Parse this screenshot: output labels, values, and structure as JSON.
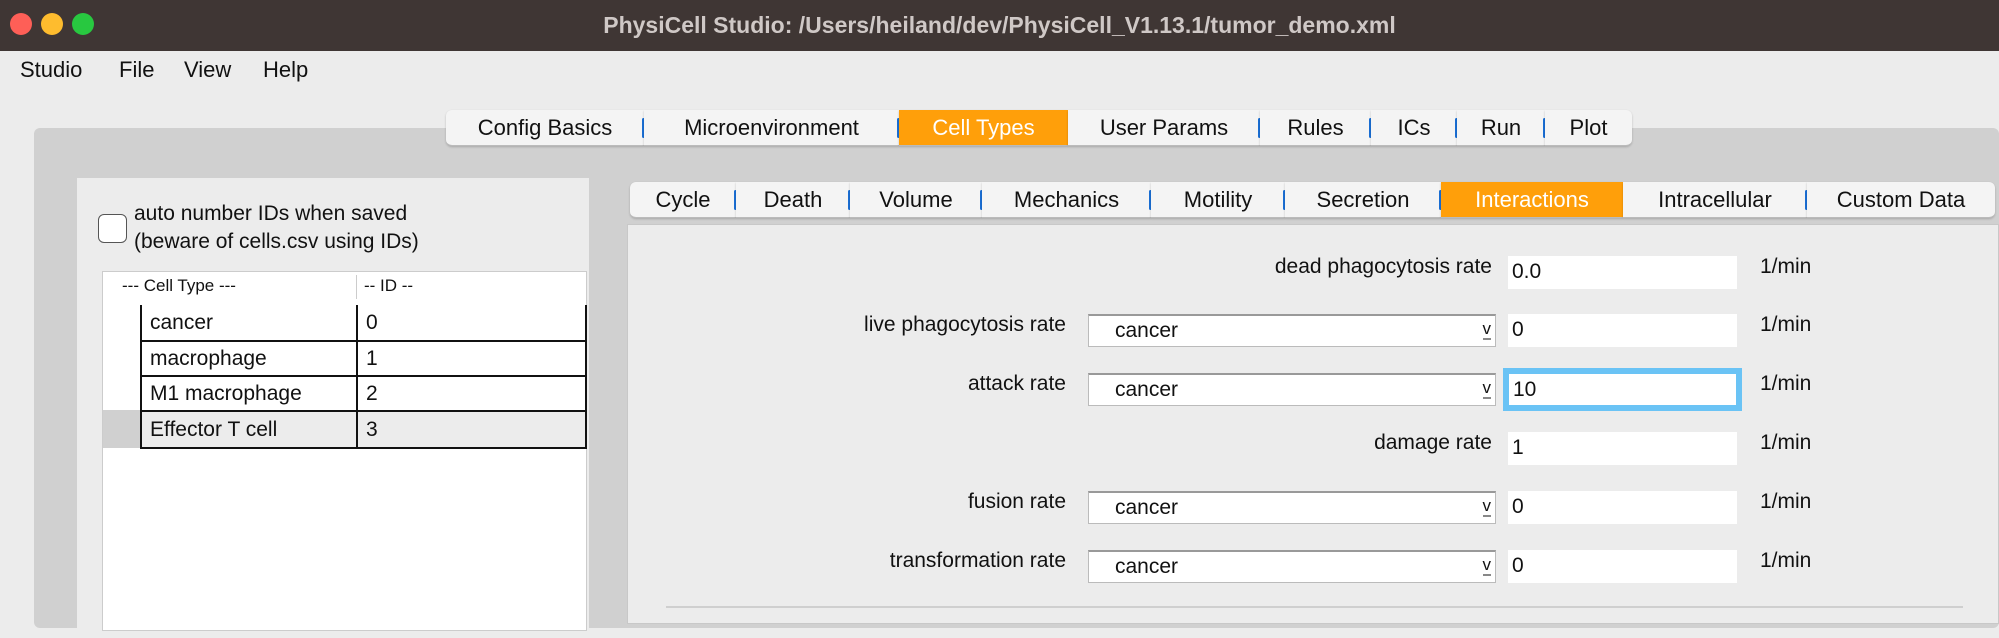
{
  "window": {
    "title": "PhysiCell Studio: /Users/heiland/dev/PhysiCell_V1.13.1/tumor_demo.xml",
    "lights": [
      "#fe5f57",
      "#febc2e",
      "#28c840"
    ]
  },
  "menu": [
    "Studio",
    "File",
    "View",
    "Help"
  ],
  "main_tabs": [
    {
      "label": "Config Basics"
    },
    {
      "label": "Microenvironment"
    },
    {
      "label": "Cell Types",
      "active": true
    },
    {
      "label": "User Params"
    },
    {
      "label": "Rules"
    },
    {
      "label": "ICs"
    },
    {
      "label": "Run"
    },
    {
      "label": "Plot"
    }
  ],
  "left": {
    "checkbox_line1": "auto number IDs when saved",
    "checkbox_line2": "(beware of cells.csv using IDs)",
    "checked": false,
    "headers": [
      "---  Cell Type ---",
      "-- ID --"
    ],
    "rows": [
      {
        "name": "cancer",
        "id": "0"
      },
      {
        "name": "macrophage",
        "id": "1"
      },
      {
        "name": "M1 macrophage",
        "id": "2"
      },
      {
        "name": "Effector T cell",
        "id": "3",
        "selected": true
      }
    ]
  },
  "sub_tabs": [
    {
      "label": "Cycle"
    },
    {
      "label": "Death"
    },
    {
      "label": "Volume"
    },
    {
      "label": "Mechanics"
    },
    {
      "label": "Motility"
    },
    {
      "label": "Secretion"
    },
    {
      "label": "Interactions",
      "active": true
    },
    {
      "label": "Intracellular"
    },
    {
      "label": "Custom Data"
    }
  ],
  "form": [
    {
      "label": "dead phagocytosis rate",
      "value": "0.0",
      "unit": "1/min"
    },
    {
      "label": "live phagocytosis rate",
      "select": "cancer",
      "value": "0",
      "unit": "1/min"
    },
    {
      "label": "attack rate",
      "select": "cancer",
      "value": "10",
      "unit": "1/min",
      "focused": true
    },
    {
      "label": "damage rate",
      "value": "1",
      "unit": "1/min"
    },
    {
      "label": "fusion rate",
      "select": "cancer",
      "value": "0",
      "unit": "1/min"
    },
    {
      "label": "transformation rate",
      "select": "cancer",
      "value": "0",
      "unit": "1/min"
    }
  ],
  "colors": {
    "accent": "#ff9f0a",
    "focus": "#6ac3f5",
    "tab_separator": "#1a6fd6"
  }
}
